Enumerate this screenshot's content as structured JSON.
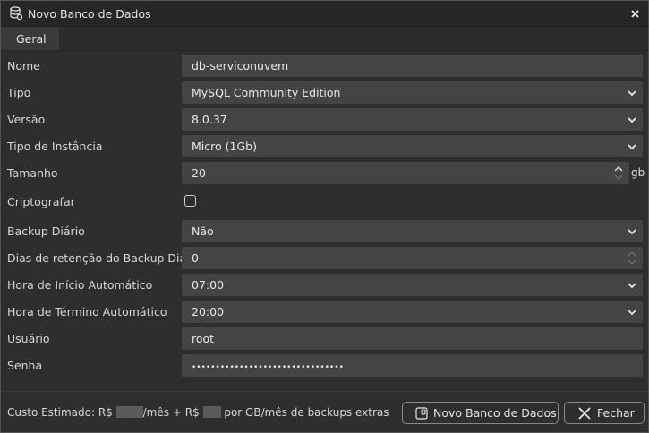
{
  "window": {
    "title": "Novo Banco de Dados"
  },
  "tabs": [
    {
      "label": "Geral"
    }
  ],
  "form": {
    "nome": {
      "label": "Nome",
      "value": "db-serviconuvem"
    },
    "tipo": {
      "label": "Tipo",
      "value": "MySQL Community Edition"
    },
    "versao": {
      "label": "Versão",
      "value": "8.0.37"
    },
    "tipo_instancia": {
      "label": "Tipo de Instância",
      "value": "Micro (1Gb)"
    },
    "tamanho": {
      "label": "Tamanho",
      "value": "20",
      "unit": "gb"
    },
    "criptografar": {
      "label": "Criptografar",
      "checked": false
    },
    "backup_diario": {
      "label": "Backup Diário",
      "value": "Não"
    },
    "dias_retencao": {
      "label": "Dias de retenção do Backup Diário",
      "value": "0"
    },
    "hora_inicio": {
      "label": "Hora de Início Automático",
      "value": "07:00"
    },
    "hora_termino": {
      "label": "Hora de Término Automático",
      "value": "20:00"
    },
    "usuario": {
      "label": "Usuário",
      "value": "root"
    },
    "senha": {
      "label": "Senha",
      "value": "••••••••••••••••••••••••••••••••"
    }
  },
  "footer": {
    "cost_prefix": "Custo Estimado:  R$",
    "cost_mid": "/mês + R$",
    "cost_suffix": "por GB/mês de backups extras",
    "create_button": "Novo Banco de Dados",
    "close_button": "Fechar"
  }
}
